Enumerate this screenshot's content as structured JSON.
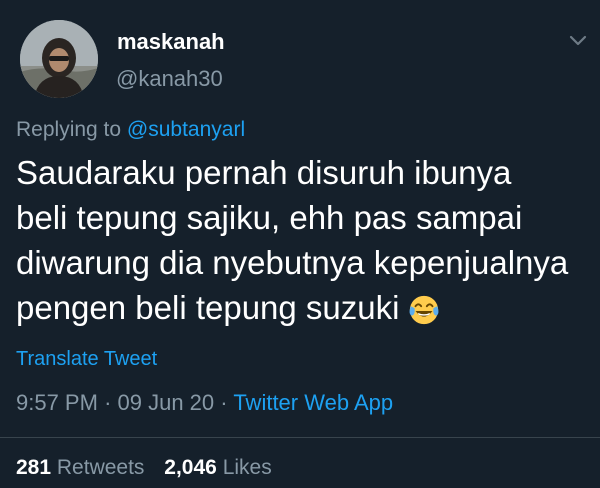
{
  "author": {
    "display_name": "maskanah",
    "handle": "@kanah30",
    "avatar_icon": "profile-photo"
  },
  "menu": {
    "icon": "chevron-down-icon"
  },
  "reply": {
    "prefix": "Replying to",
    "handle": "@subtanyarl"
  },
  "tweet": {
    "lines": [
      "Saudaraku pernah disuruh ibunya",
      "beli tepung sajiku, ehh pas sampai",
      "diwarung dia nyebutnya kepenjualnya",
      "pengen beli tepung suzuki"
    ],
    "emoji": "face-with-tears-of-joy"
  },
  "translate_label": "Translate Tweet",
  "meta": {
    "time": "9:57 PM",
    "separator": "·",
    "date": "09 Jun 20",
    "source": "Twitter Web App"
  },
  "stats": {
    "retweets_count": "281",
    "retweets_label": "Retweets",
    "likes_count": "2,046",
    "likes_label": "Likes"
  },
  "colors": {
    "background": "#15202b",
    "accent": "#1da1f2",
    "secondary_text": "#8899a6"
  }
}
